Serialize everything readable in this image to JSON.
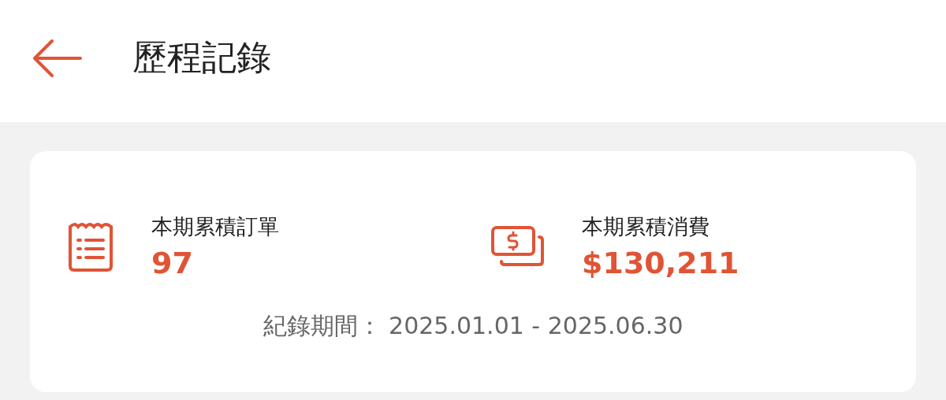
{
  "header": {
    "title": "歷程記錄"
  },
  "summary": {
    "stats": [
      {
        "kind": "orders",
        "label": "本期累積訂單",
        "value": "97"
      },
      {
        "kind": "spending",
        "label": "本期累積消費",
        "value": "$130,211"
      }
    ],
    "period_label": "紀錄期間：",
    "period": "2025.01.01 - 2025.06.30"
  }
}
